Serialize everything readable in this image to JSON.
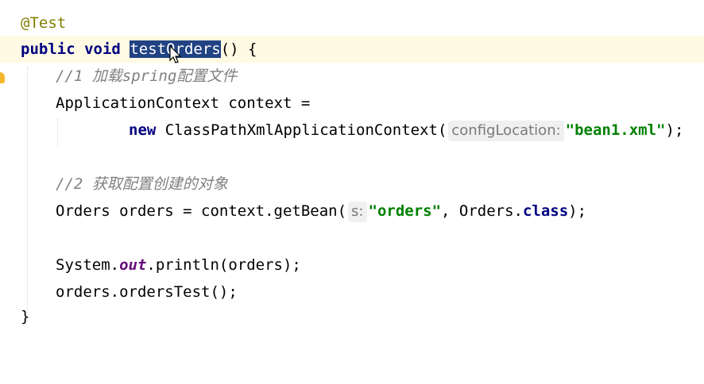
{
  "code": {
    "annotation": "@Test",
    "method_signature": {
      "keyword_public": "public",
      "keyword_void": "void",
      "method_name": "testOrders",
      "rest": "() {"
    },
    "comment1": "//1 加载spring配置文件",
    "line_context_decl": "ApplicationContext context =",
    "line_new": {
      "keyword_new": "new",
      "class_name": "ClassPathXmlApplicationContext(",
      "param_hint": "configLocation:",
      "string_value": "\"bean1.xml\"",
      "end": ");"
    },
    "comment2": "//2 获取配置创建的对象",
    "line_getbean": {
      "prefix": "Orders orders = context.getBean(",
      "param_hint": "s:",
      "string_value": "\"orders\"",
      "suffix_plain": ", Orders.",
      "keyword_class": "class",
      "end": ");"
    },
    "line_println": {
      "prefix": "System.",
      "field": "out",
      "suffix": ".println(orders);"
    },
    "line_orders_test": "orders.ordersTest();",
    "closing_brace": "}"
  },
  "colors": {
    "keyword": "#000080",
    "annotation": "#808000",
    "comment": "#808080",
    "string": "#008000",
    "selection": "#214283",
    "current_line": "#fffae3"
  },
  "icons": [
    "lightbulb-icon",
    "mouse-cursor-icon"
  ]
}
